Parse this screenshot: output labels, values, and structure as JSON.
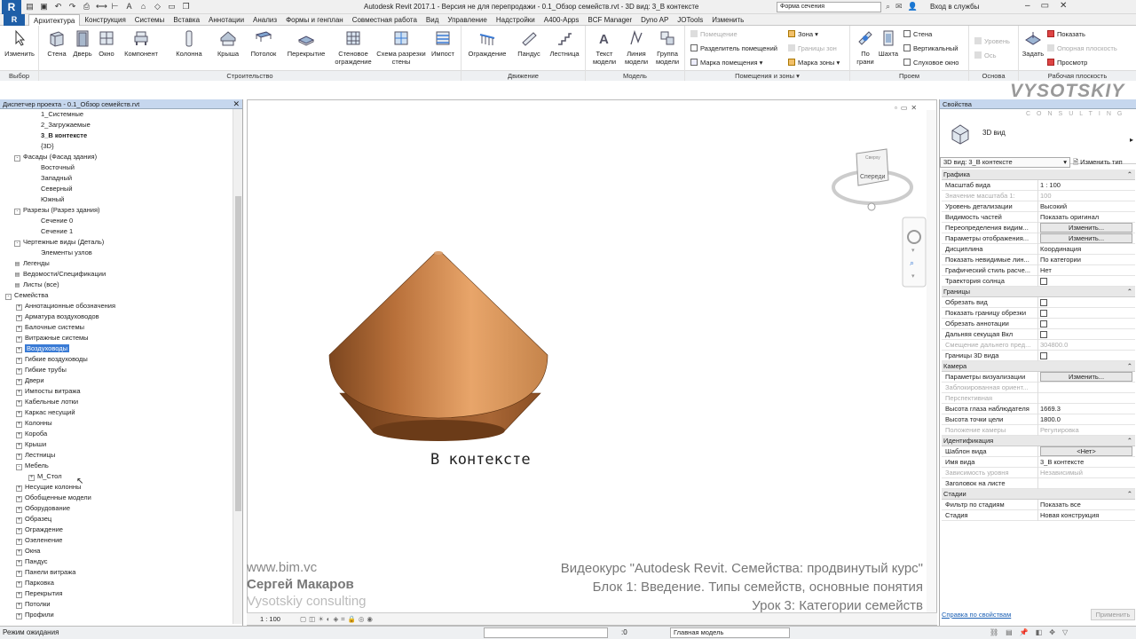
{
  "app": {
    "logo": "R",
    "title": "Autodesk Revit 2017.1 - Версия не для перепродажи -     0.1_Обзор семейств.rvt - 3D вид: 3_В контексте",
    "search_value": "Форма сечения",
    "signin": "Вход в службы"
  },
  "tabs": [
    "Архитектура",
    "Конструкция",
    "Системы",
    "Вставка",
    "Аннотации",
    "Анализ",
    "Формы и генплан",
    "Совместная работа",
    "Вид",
    "Управление",
    "Надстройки",
    "A400-Apps",
    "BCF Manager",
    "Dyno AP",
    "JOTools",
    "Изменить"
  ],
  "ribbon": {
    "groups": {
      "select": "Выбор",
      "build": "Строительство",
      "circulation": "Движение",
      "model": "Модель",
      "rooms": "Помещения и зоны",
      "opening": "Проем",
      "datum": "Основа",
      "workplane": "Рабочая плоскость"
    },
    "modify": "Изменить",
    "wall": "Стена",
    "door": "Дверь",
    "window": "Окно",
    "component": "Компонент",
    "column": "Колонна",
    "roof": "Крыша",
    "ceiling": "Потолок",
    "floor": "Перекрытие",
    "curtain_system": "Стеновое ограждение",
    "curtain_grid": "Схема разрезки стены",
    "mullion": "Импост",
    "railing": "Ограждение",
    "ramp": "Пандус",
    "stair": "Лестница",
    "model_text": "Текст модели",
    "model_line": "Линия модели",
    "model_group": "Группа модели",
    "room": "Помещение",
    "room_separator": "Разделитель помещений",
    "tag_room": "Марка помещения",
    "area": "Зона",
    "area_boundary": "Границы зон",
    "tag_area": "Марка зоны",
    "by_face": "По грани",
    "shaft": "Шахта",
    "op_wall": "Стена",
    "vertical": "Вертикальный",
    "dormer": "Слуховое окно",
    "level": "Уровень",
    "grid": "Ось",
    "set": "Задать",
    "show": "Показать",
    "ref_plane": "Опорная плоскость",
    "viewer": "Просмотр"
  },
  "browser": {
    "title": "Диспетчер проекта - 0.1_Обзор семейств.rvt",
    "items": [
      {
        "label": "1_Системные",
        "exp": ""
      },
      {
        "label": "2_Загружаемые",
        "exp": ""
      },
      {
        "label": "3_В контексте",
        "exp": ""
      },
      {
        "label": "{3D}",
        "exp": ""
      },
      {
        "label": "Фасады (Фасад здания)",
        "exp": "-"
      },
      {
        "label": "Восточный",
        "exp": ""
      },
      {
        "label": "Западный",
        "exp": ""
      },
      {
        "label": "Северный",
        "exp": ""
      },
      {
        "label": "Южный",
        "exp": ""
      },
      {
        "label": "Разрезы (Разрез здания)",
        "exp": "-"
      },
      {
        "label": "Сечение 0",
        "exp": ""
      },
      {
        "label": "Сечение 1",
        "exp": ""
      },
      {
        "label": "Чертежные виды (Деталь)",
        "exp": "-"
      },
      {
        "label": "Элементы узлов",
        "exp": ""
      },
      {
        "label": "Легенды",
        "exp": ""
      },
      {
        "label": "Ведомости/Спецификации",
        "exp": ""
      },
      {
        "label": "Листы (все)",
        "exp": ""
      },
      {
        "label": "Семейства",
        "exp": "-"
      },
      {
        "label": "Аннотационные обозначения",
        "exp": "+"
      },
      {
        "label": "Арматура воздуховодов",
        "exp": "+"
      },
      {
        "label": "Балочные системы",
        "exp": "+"
      },
      {
        "label": "Витражные системы",
        "exp": "+"
      },
      {
        "label": "Воздуховоды",
        "exp": "+"
      },
      {
        "label": "Гибкие воздуховоды",
        "exp": "+"
      },
      {
        "label": "Гибкие трубы",
        "exp": "+"
      },
      {
        "label": "Двери",
        "exp": "+"
      },
      {
        "label": "Импосты витража",
        "exp": "+"
      },
      {
        "label": "Кабельные лотки",
        "exp": "+"
      },
      {
        "label": "Каркас несущий",
        "exp": "+"
      },
      {
        "label": "Колонны",
        "exp": "+"
      },
      {
        "label": "Короба",
        "exp": "+"
      },
      {
        "label": "Крыши",
        "exp": "+"
      },
      {
        "label": "Лестницы",
        "exp": "+"
      },
      {
        "label": "Мебель",
        "exp": "-"
      },
      {
        "label": "М_Стол",
        "exp": "+"
      },
      {
        "label": "Несущие колонны",
        "exp": "+"
      },
      {
        "label": "Обобщенные модели",
        "exp": "+"
      },
      {
        "label": "Оборудование",
        "exp": "+"
      },
      {
        "label": "Образец",
        "exp": "+"
      },
      {
        "label": "Ограждение",
        "exp": "+"
      },
      {
        "label": "Озеленение",
        "exp": "+"
      },
      {
        "label": "Окна",
        "exp": "+"
      },
      {
        "label": "Пандус",
        "exp": "+"
      },
      {
        "label": "Панели витража",
        "exp": "+"
      },
      {
        "label": "Парковка",
        "exp": "+"
      },
      {
        "label": "Перекрытия",
        "exp": "+"
      },
      {
        "label": "Потолки",
        "exp": "+"
      },
      {
        "label": "Профили",
        "exp": "+"
      }
    ]
  },
  "viewport": {
    "caption": "В контексте",
    "viewcube_face": "Спереди",
    "viewcube_top": "Сверху",
    "scale": "1 : 100",
    "watermark": [
      "www.bim.vc",
      "Сергей Макаров",
      "Vysotskiy consulting"
    ],
    "course": [
      "Видеокурс \"Autodesk Revit. Семейства: продвинутый курс\"",
      "Блок 1: Введение. Типы семейств, основные понятия",
      "Урок 3: Категории семейств"
    ]
  },
  "properties": {
    "title": "Свойства",
    "type_name": "3D вид",
    "selector": "3D вид: 3_В контексте",
    "edit_type": "Изменить тип",
    "help": "Справка по свойствам",
    "apply": "Применить",
    "brand": "VYSOTSKIY",
    "brand_sub": "CONSULTING",
    "rows": [
      {
        "kind": "cat",
        "name": "Графика"
      },
      {
        "kind": "row",
        "name": "Масштаб вида",
        "value": "1 : 100"
      },
      {
        "kind": "dim",
        "name": "Значение масштаба   1:",
        "value": "100"
      },
      {
        "kind": "row",
        "name": "Уровень детализации",
        "value": "Высокий"
      },
      {
        "kind": "row",
        "name": "Видимость частей",
        "value": "Показать оригинал"
      },
      {
        "kind": "btn",
        "name": "Переопределения видим...",
        "value": "Изменить..."
      },
      {
        "kind": "btn",
        "name": "Параметры отображения...",
        "value": "Изменить..."
      },
      {
        "kind": "row",
        "name": "Дисциплина",
        "value": "Координация"
      },
      {
        "kind": "row",
        "name": "Показать невидимые лин...",
        "value": "По категории"
      },
      {
        "kind": "row",
        "name": "Графический стиль расче...",
        "value": "Нет"
      },
      {
        "kind": "chk",
        "name": "Траектория солнца",
        "value": ""
      },
      {
        "kind": "cat",
        "name": "Границы"
      },
      {
        "kind": "chk",
        "name": "Обрезать вид",
        "value": ""
      },
      {
        "kind": "chk",
        "name": "Показать границу обрезки",
        "value": ""
      },
      {
        "kind": "chk",
        "name": "Обрезать аннотации",
        "value": ""
      },
      {
        "kind": "chk",
        "name": "Дальняя секущая Вкл",
        "value": ""
      },
      {
        "kind": "dim",
        "name": "Смещение дальнего пред...",
        "value": "304800.0"
      },
      {
        "kind": "chk",
        "name": "Границы 3D вида",
        "value": ""
      },
      {
        "kind": "cat",
        "name": "Камера"
      },
      {
        "kind": "btn",
        "name": "Параметры визуализации",
        "value": "Изменить..."
      },
      {
        "kind": "dim",
        "name": "Заблокированная ориент...",
        "value": ""
      },
      {
        "kind": "dim",
        "name": "Перспективная",
        "value": ""
      },
      {
        "kind": "row",
        "name": "Высота глаза наблюдателя",
        "value": "1669.3"
      },
      {
        "kind": "row",
        "name": "Высота точки цели",
        "value": "1800.0"
      },
      {
        "kind": "dim",
        "name": "Положение камеры",
        "value": "Регулировка"
      },
      {
        "kind": "cat",
        "name": "Идентификация"
      },
      {
        "kind": "btn",
        "name": "Шаблон вида",
        "value": "<Нет>"
      },
      {
        "kind": "row",
        "name": "Имя вида",
        "value": "3_В контексте"
      },
      {
        "kind": "dim",
        "name": "Зависимость уровня",
        "value": "Независимый"
      },
      {
        "kind": "row",
        "name": "Заголовок на листе",
        "value": ""
      },
      {
        "kind": "cat",
        "name": "Стадии"
      },
      {
        "kind": "row",
        "name": "Фильтр по стадиям",
        "value": "Показать все"
      },
      {
        "kind": "row",
        "name": "Стадия",
        "value": "Новая конструкция"
      }
    ]
  },
  "status": {
    "text": "Режим ожидания",
    "zero": ":0",
    "model": "Главная модель"
  },
  "colors": {
    "accent": "#1f5fa8",
    "selection": "#3a7bd5",
    "cone_light": "#e39a5c",
    "cone_dark": "#8a4f22"
  }
}
